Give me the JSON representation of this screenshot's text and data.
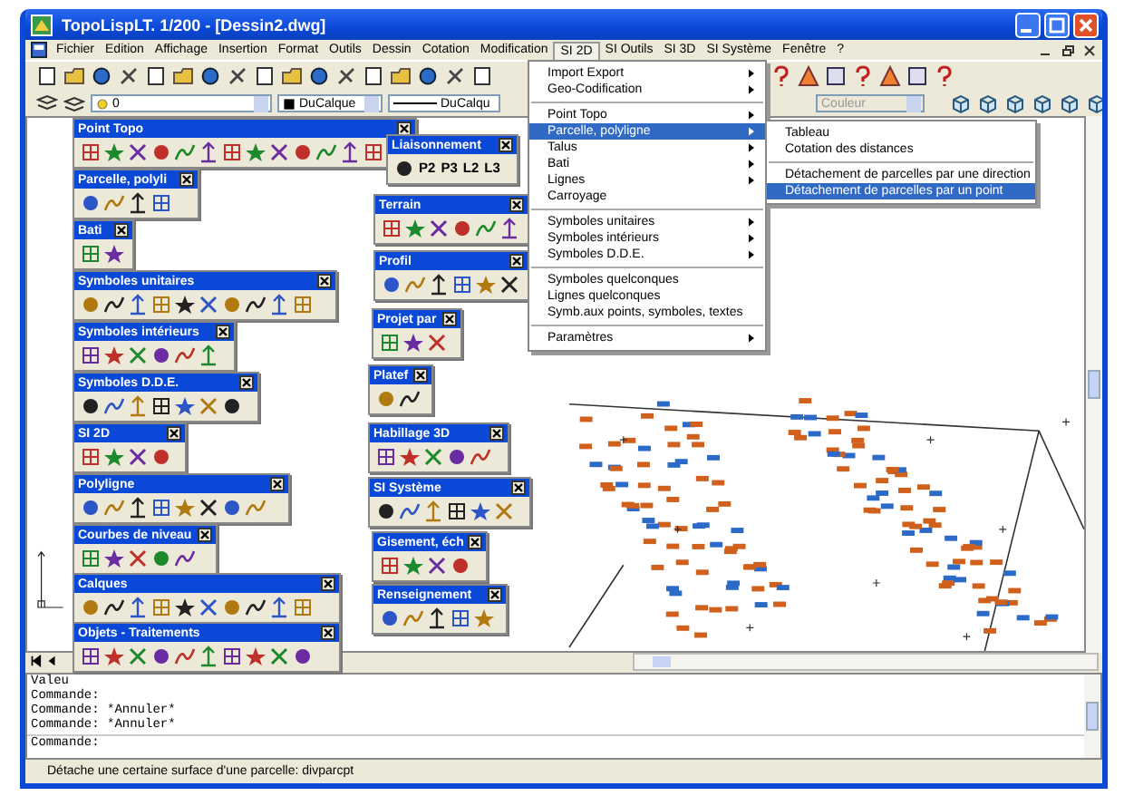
{
  "window": {
    "title": "TopoLispLT. 1/200 - [Dessin2.dwg]"
  },
  "menu_bar": [
    {
      "label": "Fichier",
      "selected": false
    },
    {
      "label": "Edition",
      "selected": false
    },
    {
      "label": "Affichage",
      "selected": false
    },
    {
      "label": "Insertion",
      "selected": false
    },
    {
      "label": "Format",
      "selected": false
    },
    {
      "label": "Outils",
      "selected": false
    },
    {
      "label": "Dessin",
      "selected": false
    },
    {
      "label": "Cotation",
      "selected": false
    },
    {
      "label": "Modification",
      "selected": false
    },
    {
      "label": "SI 2D",
      "selected": true
    },
    {
      "label": "SI Outils",
      "selected": false
    },
    {
      "label": "SI 3D",
      "selected": false
    },
    {
      "label": "SI Système",
      "selected": false
    },
    {
      "label": "Fenêtre",
      "selected": false
    },
    {
      "label": "?",
      "selected": false
    }
  ],
  "layer_toolbar": {
    "layer": "0",
    "color_setting": "DuCalque",
    "linetype": "DuCalqu",
    "plot_color": "Couleur"
  },
  "floating_toolbars": [
    {
      "title": "Point Topo"
    },
    {
      "title": "Parcelle, polyli"
    },
    {
      "title": "Bati"
    },
    {
      "title": "Symboles unitaires"
    },
    {
      "title": "Symboles intérieurs"
    },
    {
      "title": "Symboles D.D.E."
    },
    {
      "title": "SI 2D"
    },
    {
      "title": "Polyligne"
    },
    {
      "title": "Courbes de niveau"
    },
    {
      "title": "Calques"
    },
    {
      "title": "Objets - Traitements"
    },
    {
      "title": "Liaisonnement",
      "labels": [
        "P2",
        "P3",
        "L2",
        "L3"
      ]
    },
    {
      "title": "Terrain"
    },
    {
      "title": "Profil"
    },
    {
      "title": "Projet par"
    },
    {
      "title": "Platef"
    },
    {
      "title": "Habillage 3D"
    },
    {
      "title": "SI Système"
    },
    {
      "title": "Gisement, éch"
    },
    {
      "title": "Renseignement"
    }
  ],
  "menu": {
    "items": [
      {
        "kind": "item",
        "label": "Import Export",
        "submenu": true,
        "selected": false
      },
      {
        "kind": "item",
        "label": "Geo-Codification",
        "submenu": true,
        "selected": false
      },
      {
        "kind": "separator"
      },
      {
        "kind": "item",
        "label": "Point Topo",
        "submenu": true,
        "selected": false
      },
      {
        "kind": "item",
        "label": "Parcelle, polyligne",
        "submenu": true,
        "selected": true
      },
      {
        "kind": "item",
        "label": "Talus",
        "submenu": true,
        "selected": false
      },
      {
        "kind": "item",
        "label": "Bati",
        "submenu": true,
        "selected": false
      },
      {
        "kind": "item",
        "label": "Lignes",
        "submenu": true,
        "selected": false
      },
      {
        "kind": "item",
        "label": "Carroyage",
        "submenu": false,
        "selected": false
      },
      {
        "kind": "separator"
      },
      {
        "kind": "item",
        "label": "Symboles unitaires",
        "submenu": true,
        "selected": false
      },
      {
        "kind": "item",
        "label": "Symboles intérieurs",
        "submenu": true,
        "selected": false
      },
      {
        "kind": "item",
        "label": "Symboles D.D.E.",
        "submenu": true,
        "selected": false
      },
      {
        "kind": "separator"
      },
      {
        "kind": "item",
        "label": "Symboles quelconques",
        "submenu": false,
        "selected": false
      },
      {
        "kind": "item",
        "label": "Lignes quelconques",
        "submenu": false,
        "selected": false
      },
      {
        "kind": "item",
        "label": "Symb.aux points, symboles, textes",
        "submenu": false,
        "selected": false
      },
      {
        "kind": "separator"
      },
      {
        "kind": "item",
        "label": "Paramètres",
        "submenu": true,
        "selected": false
      }
    ]
  },
  "submenu": {
    "items": [
      {
        "kind": "item",
        "label": "Tableau",
        "selected": false
      },
      {
        "kind": "item",
        "label": "Cotation des distances",
        "selected": false
      },
      {
        "kind": "separator"
      },
      {
        "kind": "item",
        "label": "Détachement de parcelles par une direction",
        "selected": false
      },
      {
        "kind": "item",
        "label": "Détachement de parcelles par un point",
        "selected": true
      }
    ]
  },
  "command_line": {
    "history": [
      "Valeu",
      "Commande:",
      "Commande: *Annuler*",
      "Commande: *Annuler*"
    ],
    "prompt": "Commande:"
  },
  "status_bar": "Détache une certaine surface d'une parcelle: divparcpt"
}
